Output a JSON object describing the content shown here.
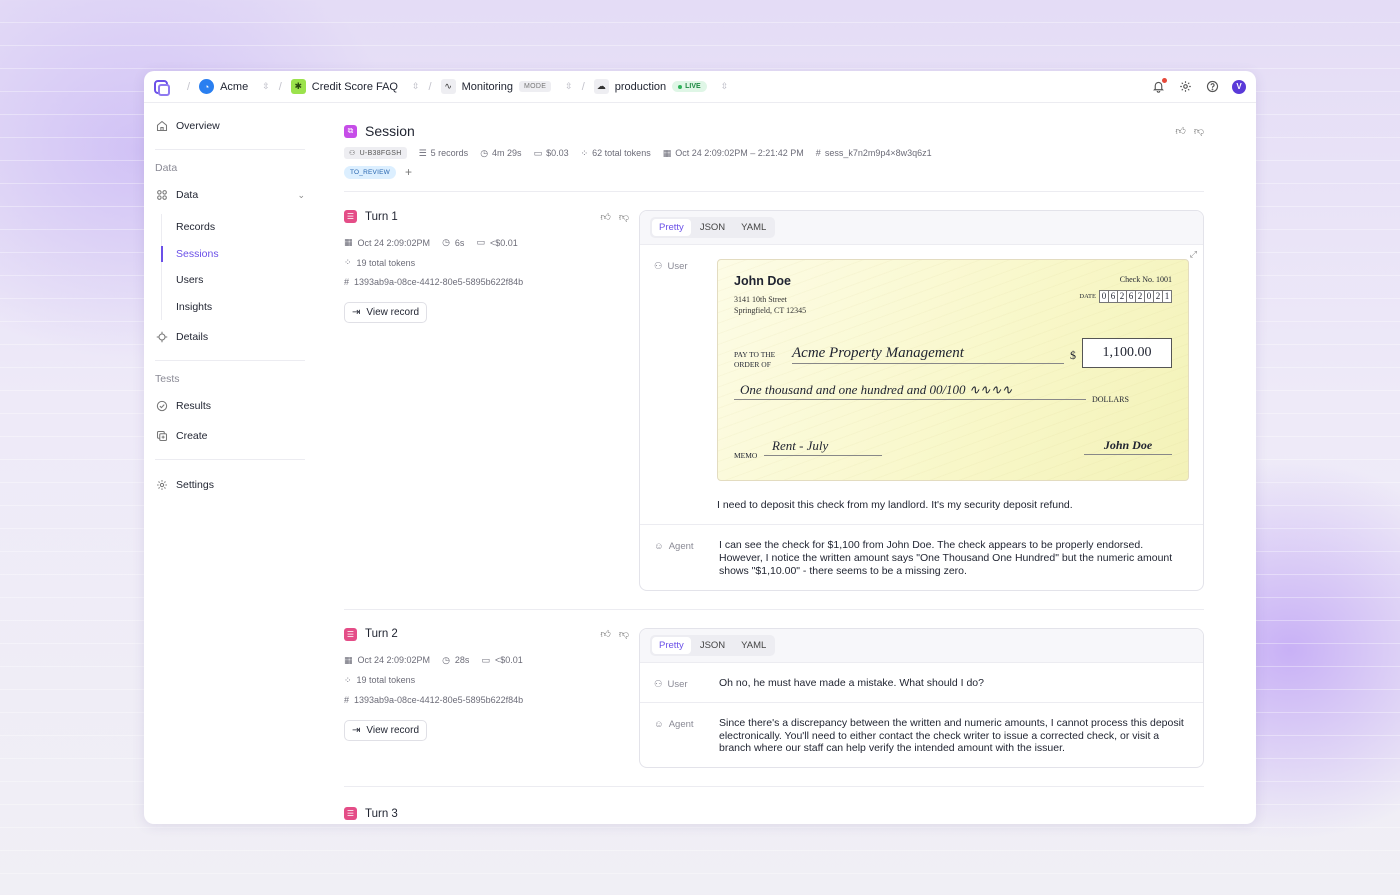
{
  "topbar": {
    "org": "Acme",
    "project": "Credit Score FAQ",
    "mode_name": "Monitoring",
    "mode_badge": "MODE",
    "env": "production",
    "env_badge": "LIVE",
    "avatar_initial": "V"
  },
  "sidebar": {
    "overview": "Overview",
    "data_section": "Data",
    "data_group": "Data",
    "data_items": [
      "Records",
      "Sessions",
      "Users",
      "Insights"
    ],
    "active_item": "Sessions",
    "details": "Details",
    "tests_section": "Tests",
    "results": "Results",
    "create": "Create",
    "settings": "Settings"
  },
  "session": {
    "title": "Session",
    "user_id": "U-B38FGSH",
    "records": "5 records",
    "duration": "4m 29s",
    "cost": "$0.03",
    "tokens": "62 total tokens",
    "time_range": "Oct 24 2:09:02PM – 2:21:42 PM",
    "session_id": "sess_k7n2m9p4×8w3q6z1",
    "tag": "TO_REVIEW"
  },
  "tabs": [
    "Pretty",
    "JSON",
    "YAML"
  ],
  "roles": {
    "user": "User",
    "agent": "Agent"
  },
  "turns": [
    {
      "title": "Turn 1",
      "time": "Oct 24 2:09:02PM",
      "duration": "6s",
      "cost": "<$0.01",
      "tokens": "19 total tokens",
      "id": "1393ab9a-08ce-4412-80e5-5895b622f84b",
      "view": "View record",
      "user_text": "I need to deposit this check from my landlord. It's my security deposit refund.",
      "agent_text": " I can see the check for $1,100 from John Doe. The check appears to be properly endorsed. However, I notice the written amount says \"One Thousand One Hundred\" but the numeric amount shows \"$1,10.00\" - there seems to be a missing zero."
    },
    {
      "title": "Turn 2",
      "time": "Oct 24 2:09:02PM",
      "duration": "28s",
      "cost": "<$0.01",
      "tokens": "19 total tokens",
      "id": "1393ab9a-08ce-4412-80e5-5895b622f84b",
      "view": "View record",
      "user_text": "Oh no, he must have made a mistake. What should I do?",
      "agent_text": "Since there's a discrepancy between the written and numeric amounts, I cannot process this deposit electronically. You'll need to either contact the check writer to issue a corrected check, or visit a branch where our staff can help verify the intended amount with the issuer."
    },
    {
      "title": "Turn 3"
    }
  ],
  "check": {
    "name": "John Doe",
    "addr1": "3141 10th Street",
    "addr2": "Springfield, CT 12345",
    "check_no": "Check No. 1001",
    "date_label": "DATE",
    "date_digits": [
      "0",
      "6",
      "2",
      "6",
      "2",
      "0",
      "2",
      "1"
    ],
    "pay_label_1": "PAY TO THE",
    "pay_label_2": "ORDER OF",
    "payee": "Acme Property Management",
    "dollar_sign": "$",
    "amount": "1,100.00",
    "words": "One thousand and one hundred and 00/100",
    "dollars_label": "DOLLARS",
    "memo_label": "MEMO",
    "memo": "Rent - July",
    "signature": "John Doe"
  }
}
